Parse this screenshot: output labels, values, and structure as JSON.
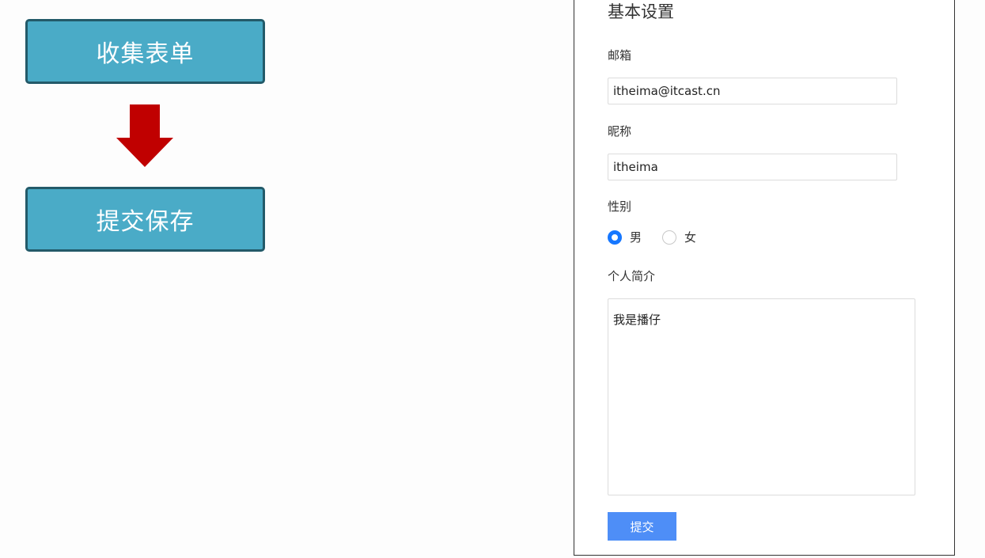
{
  "flow": {
    "step1": "收集表单",
    "step2": "提交保存",
    "arrow_color": "#c00000",
    "box_color": "#4aabc7"
  },
  "form": {
    "title": "基本设置",
    "email_label": "邮箱",
    "email_value": "itheima@itcast.cn",
    "nickname_label": "昵称",
    "nickname_value": "itheima",
    "gender_label": "性别",
    "gender_options": [
      "男",
      "女"
    ],
    "gender_selected": "男",
    "bio_label": "个人简介",
    "bio_value": "我是播仔",
    "submit_label": "提交",
    "accent_color": "#1677ff"
  }
}
